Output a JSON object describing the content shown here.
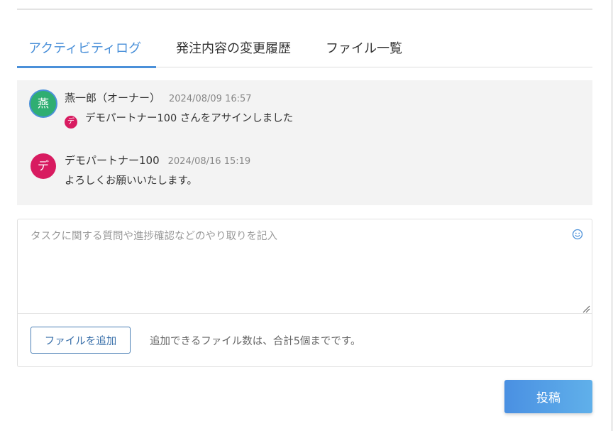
{
  "tabs": [
    {
      "label": "アクティビティログ",
      "active": true
    },
    {
      "label": "発注内容の変更履歴",
      "active": false
    },
    {
      "label": "ファイル一覧",
      "active": false
    }
  ],
  "activity": [
    {
      "avatar_char": "燕",
      "avatar_color": "#2fae72",
      "author": "燕一郎（オーナー）",
      "time": "2024/08/09 16:57",
      "mini_avatar_char": "デ",
      "message": "デモパートナー100 さんをアサインしました"
    },
    {
      "avatar_char": "デ",
      "avatar_color": "#d81b60",
      "author": "デモパートナー100",
      "time": "2024/08/16 15:19",
      "message": "よろしくお願いいたします。"
    }
  ],
  "composer": {
    "placeholder": "タスクに関する質問や進捗確認などのやり取りを記入",
    "value": "",
    "emoji_icon": "smiley-icon",
    "add_file_label": "ファイルを追加",
    "file_note": "追加できるファイル数は、合計5個までです。"
  },
  "post_label": "投稿",
  "colors": {
    "accent": "#4a90d9",
    "log_background": "#f3f3f3",
    "post_gradient_start": "#4a90e2",
    "post_gradient_end": "#60b0ea"
  }
}
